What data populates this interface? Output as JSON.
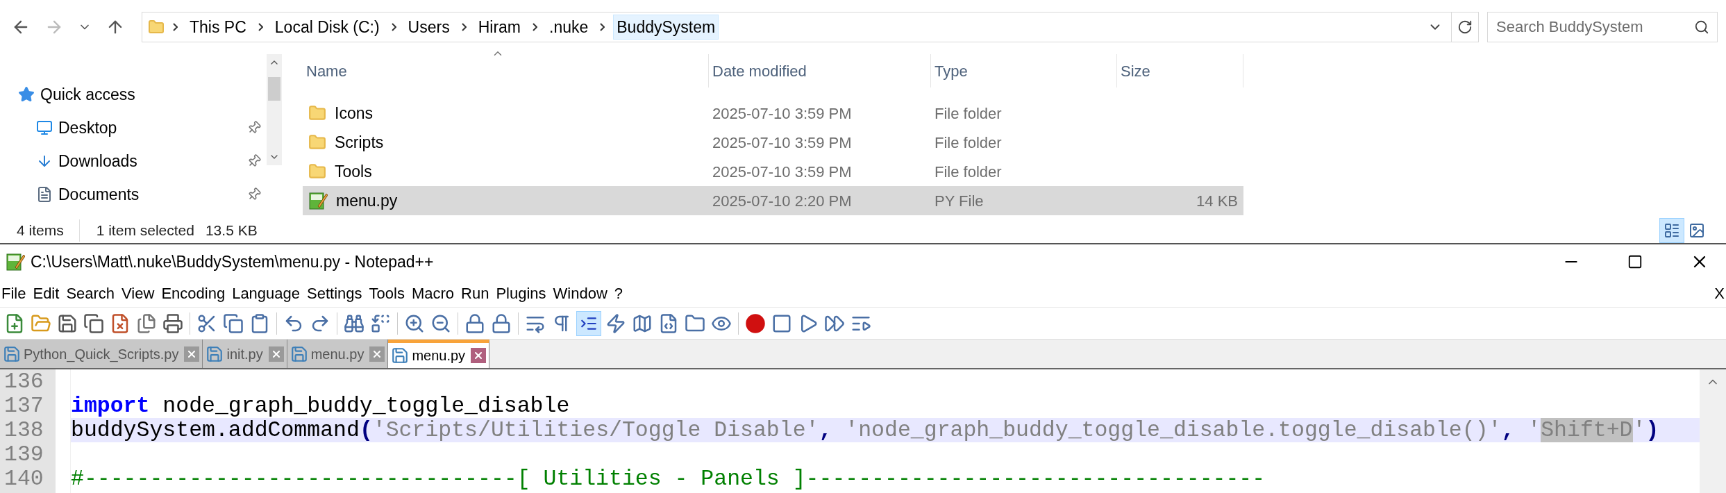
{
  "explorer": {
    "breadcrumb": [
      {
        "label": "This PC",
        "selected": false
      },
      {
        "label": "Local Disk (C:)",
        "selected": false
      },
      {
        "label": "Users",
        "selected": false
      },
      {
        "label": "Hiram",
        "selected": false
      },
      {
        "label": ".nuke",
        "selected": false
      },
      {
        "label": "BuddySystem",
        "selected": true
      }
    ],
    "search": {
      "placeholder": "Search BuddySystem"
    },
    "sidebar": {
      "items": [
        {
          "label": "Quick access",
          "kind": "star",
          "pinned": false,
          "children": [
            {
              "label": "Desktop",
              "kind": "desktop",
              "pinned": true
            },
            {
              "label": "Downloads",
              "kind": "download",
              "pinned": true
            },
            {
              "label": "Documents",
              "kind": "document",
              "pinned": true
            }
          ]
        }
      ]
    },
    "columns": [
      "Name",
      "Date modified",
      "Type",
      "Size"
    ],
    "rows": [
      {
        "name": "Icons",
        "kind": "folder",
        "date": "2025-07-10 3:59 PM",
        "type": "File folder",
        "selected": false
      },
      {
        "name": "Scripts",
        "kind": "folder",
        "date": "2025-07-10 3:59 PM",
        "type": "File folder",
        "selected": false
      },
      {
        "name": "Tools",
        "kind": "folder",
        "date": "2025-07-10 3:59 PM",
        "type": "File folder",
        "selected": false
      },
      {
        "name": "menu.py",
        "kind": "python",
        "date": "2025-07-10 2:20 PM",
        "type": "PY File",
        "size": "14 KB",
        "selected": true
      }
    ],
    "status_bar": [
      "4 items",
      "1 item selected",
      "13.5 KB"
    ],
    "view_buttons": [
      {
        "kind": "details",
        "selected": true
      },
      {
        "kind": "thumbnails",
        "selected": false
      }
    ]
  },
  "notepad": {
    "window": {
      "title": "C:\\Users\\Matt\\.nuke\\BuddySystem\\menu.py - Notepad++"
    },
    "menu": [
      "File",
      "Edit",
      "Search",
      "View",
      "Encoding",
      "Language",
      "Settings",
      "Tools",
      "Macro",
      "Run",
      "Plugins",
      "Window",
      "?"
    ],
    "menu_close": "X",
    "toolbar": {
      "indent_guide": {
        "on": true
      }
    },
    "tabs": [
      {
        "label": "Python_Quick_Scripts.py",
        "selected": false
      },
      {
        "label": "init.py",
        "selected": false
      },
      {
        "label": "menu.py",
        "selected": false
      },
      {
        "label": "menu.py",
        "selected": true
      }
    ],
    "lines": [
      {
        "number": "136"
      },
      {
        "number": "137",
        "tokens": [
          {
            "kind": "keyword",
            "text": "import"
          },
          {
            "kind": "plain",
            "text": " node_graph_buddy_toggle_disable"
          }
        ]
      },
      {
        "number": "138",
        "current": true,
        "tokens": [
          {
            "kind": "plain",
            "text": "buddySystem.addCommand"
          },
          {
            "kind": "operator",
            "text": "("
          },
          {
            "kind": "string",
            "text": "'Scripts/Utilities/Toggle Disable'"
          },
          {
            "kind": "operator",
            "text": ","
          },
          {
            "kind": "string",
            "text": " 'node_graph_buddy_toggle_disable.toggle_disable()'"
          },
          {
            "kind": "operator",
            "text": ","
          },
          {
            "kind": "string",
            "text": " '"
          },
          {
            "kind": "selection",
            "text": "Shift+D"
          },
          {
            "kind": "string",
            "text": "'"
          },
          {
            "kind": "operator",
            "text": ")"
          }
        ]
      },
      {
        "number": "139"
      },
      {
        "number": "140",
        "tokens": [
          {
            "kind": "comment",
            "text": "#---------------------------------[ Utilities - Panels ]-----------------------------------"
          }
        ]
      }
    ]
  }
}
